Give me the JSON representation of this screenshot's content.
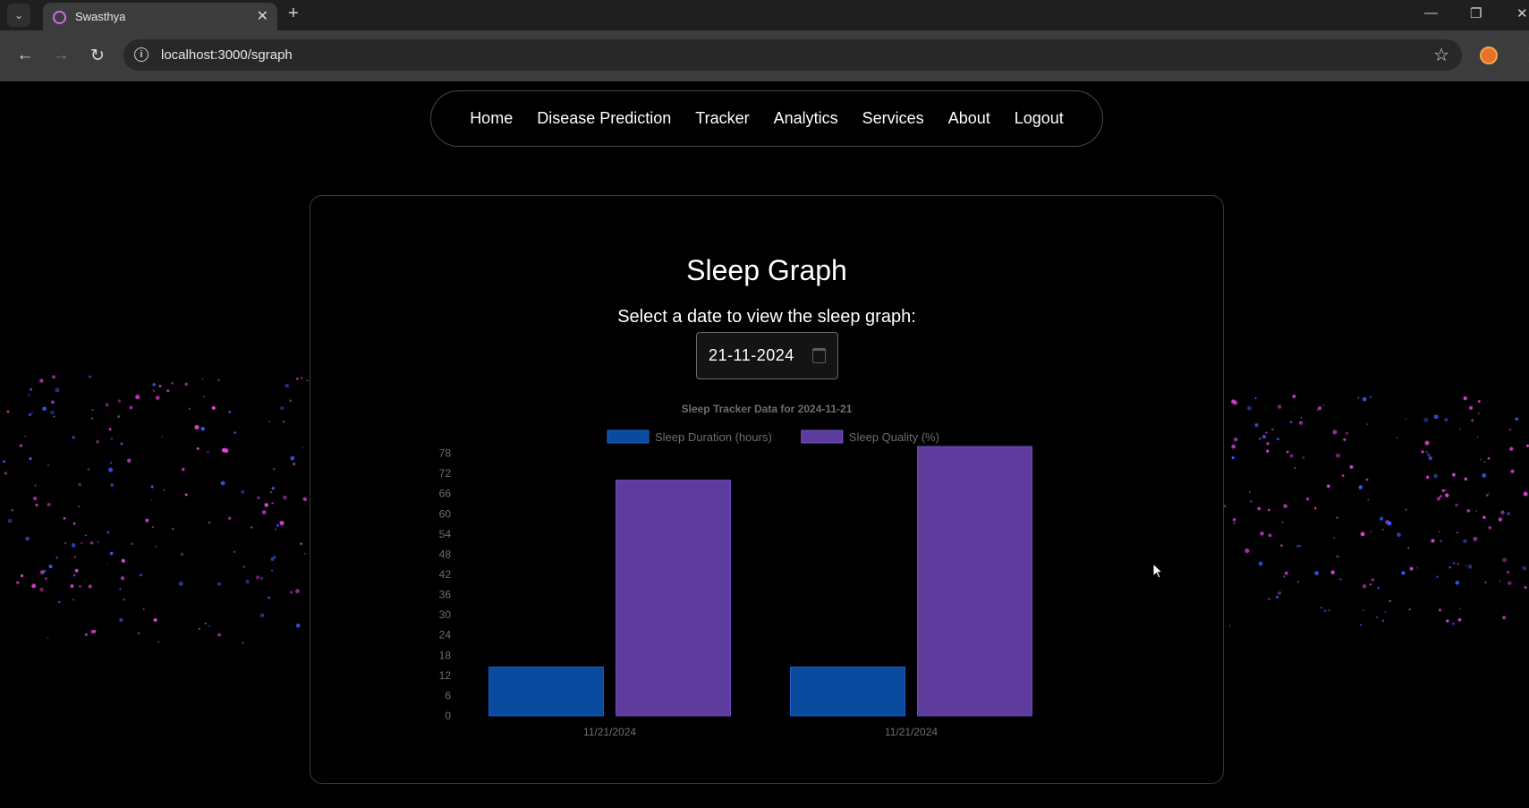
{
  "browser": {
    "tab_title": "Swasthya",
    "url": "localhost:3000/sgraph"
  },
  "navbar": {
    "items": [
      {
        "label": "Home"
      },
      {
        "label": "Disease Prediction"
      },
      {
        "label": "Tracker"
      },
      {
        "label": "Analytics"
      },
      {
        "label": "Services"
      },
      {
        "label": "About"
      },
      {
        "label": "Logout"
      }
    ]
  },
  "page": {
    "title": "Sleep Graph",
    "prompt": "Select a date to view the sleep graph:",
    "date_value": "21-11-2024"
  },
  "colors": {
    "background": "#000000",
    "duration_bar": "#0a4ba0",
    "quality_bar": "#5e3c9e",
    "particles": [
      "#e040e0",
      "#3a5cff"
    ]
  },
  "chart_data": {
    "type": "bar",
    "title": "Sleep Tracker Data for 2024-11-21",
    "legend_position": "top",
    "categories": [
      "11/21/2024",
      "11/21/2024"
    ],
    "series": [
      {
        "name": "Sleep Duration (hours)",
        "color": "#0a4ba0",
        "values": [
          14.5,
          14.5
        ]
      },
      {
        "name": "Sleep Quality (%)",
        "color": "#5e3c9e",
        "values": [
          70,
          80
        ]
      }
    ],
    "y_ticks": [
      0,
      6,
      12,
      18,
      24,
      30,
      36,
      42,
      48,
      54,
      60,
      66,
      72,
      78
    ],
    "ylim": [
      0,
      80
    ],
    "grid": false
  }
}
